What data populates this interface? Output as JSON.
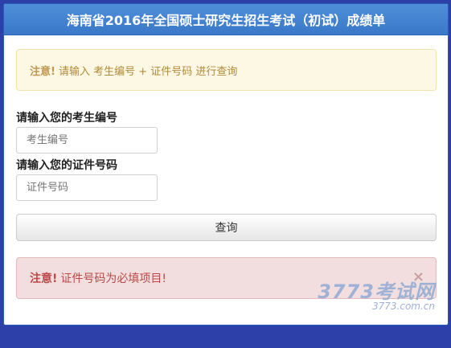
{
  "header": {
    "title": "海南省2016年全国硕士研究生招生考试（初试）成绩单"
  },
  "notice": {
    "strong": "注意!",
    "text": "请输入 考生编号 + 证件号码 进行查询"
  },
  "form": {
    "exam_number_label": "请输入您的考生编号",
    "exam_number_placeholder": "考生编号",
    "id_number_label": "请输入您的证件号码",
    "id_number_placeholder": "证件号码",
    "submit_label": "查询"
  },
  "error": {
    "strong": "注意!",
    "text": "证件号码为必填项目!",
    "close_symbol": "×"
  },
  "watermark": {
    "main": "3773考试网",
    "sub": "3773.com.cn"
  },
  "colors": {
    "background": "#2d3fa8",
    "header": "#3a78c8",
    "warning_bg": "#fcf8e3",
    "error_bg": "#f2dede",
    "error_text": "#b94a48"
  }
}
